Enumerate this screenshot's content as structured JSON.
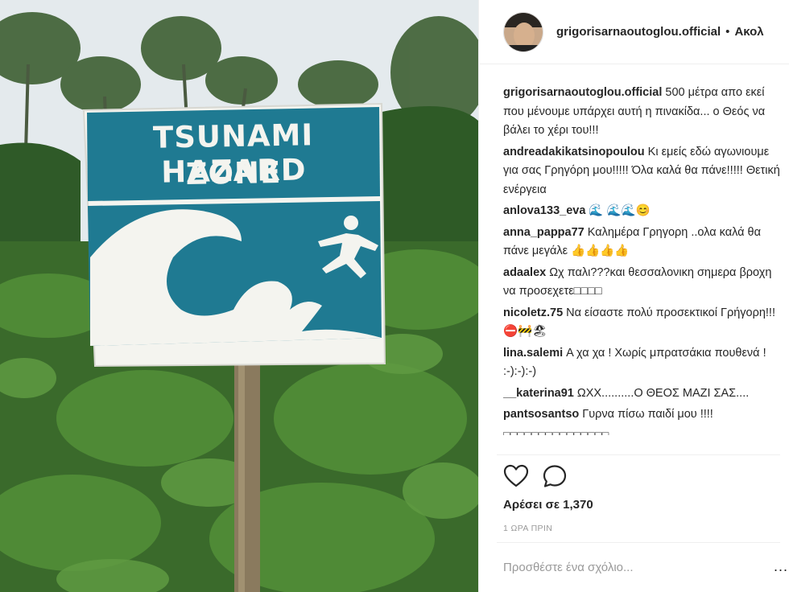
{
  "sign": {
    "line1": "TSUNAMI HAZARD",
    "line2": "ZONE"
  },
  "post": {
    "username": "grigorisarnaoutoglou.official",
    "separator": "•",
    "follow_label": "Ακολ",
    "likes_text": "Αρέσει σε 1,370",
    "time_ago": "1 ΩΡΑ ΠΡΙΝ",
    "add_comment_placeholder": "Προσθέστε ένα σχόλιο...",
    "more_label": "..."
  },
  "comments": [
    {
      "user": "grigorisarnaoutoglou.official",
      "text": "500 μέτρα απο εκεί που μένουμε υπάρχει αυτή η πινακίδα... ο Θεός να βάλει το χέρι του!!!"
    },
    {
      "user": "andreadakikatsinopoulou",
      "text": "Κι εμείς εδώ αγωνιουμε για σας Γρηγόρη μου!!!!! Όλα καλά θα πάνε!!!!! Θετική ενέργεια"
    },
    {
      "user": "anlova133_eva",
      "text": "🌊 🌊🌊😊"
    },
    {
      "user": "anna_pappa77",
      "text": "Καλημέρα Γρηγορη ..ολα καλά θα πάνε μεγάλε 👍👍👍👍"
    },
    {
      "user": "adaalex",
      "text": "Ωχ παλι???και θεσσαλονικη σημερα βροχη να προσεχετε□□□□"
    },
    {
      "user": "nicoletz.75",
      "text": "Να είσαστε πολύ προσεκτικοί Γρήγορη!!!⛔🚧🏖"
    },
    {
      "user": "lina.salemi",
      "text": "Α χα χα ! Χωρίς μπρατσάκια πουθενά ! :-):-):-)"
    },
    {
      "user": "__katerina91",
      "text": "ΩΧΧ..........Ο ΘΕΟΣ ΜΑΖΙ ΣΑΣ...."
    },
    {
      "user": "pantsosantso",
      "text": "Γυρνα πίσω παιδί μου !!!!"
    }
  ],
  "partial_comment": "□□□□□□□□□□□□□□□",
  "colors": {
    "sign_blue": "#1f7a92",
    "sign_white": "#f4f4ef",
    "text_dark": "#262626",
    "muted": "#999999",
    "foliage": "#3f6a2e"
  },
  "icons": [
    "heart-icon",
    "comment-icon",
    "more-icon"
  ]
}
